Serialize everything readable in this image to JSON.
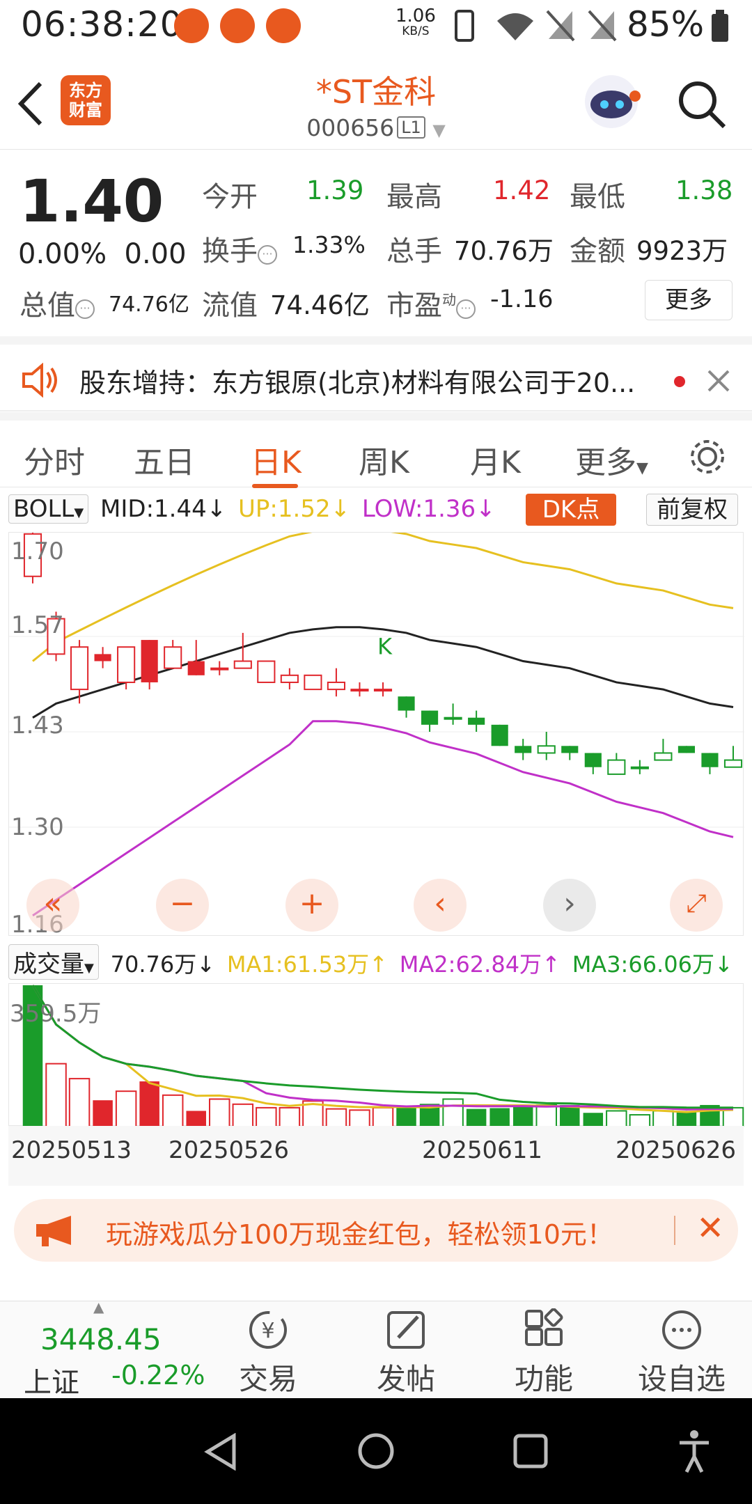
{
  "status_bar": {
    "time": "06:38:20",
    "speed_value": "1.06",
    "speed_unit": "KB/S",
    "battery": "85%"
  },
  "header": {
    "title": "*ST金科",
    "code": "000656",
    "level": "L1",
    "logo_text": "东方财富"
  },
  "quote": {
    "price": "1.40",
    "change_pct": "0.00%",
    "change": "0.00",
    "open_label": "今开",
    "open": "1.39",
    "high_label": "最高",
    "high": "1.42",
    "low_label": "最低",
    "low": "1.38",
    "turnover_label": "换手",
    "turnover": "1.33%",
    "volume_label": "总手",
    "volume": "70.76万",
    "amount_label": "金额",
    "amount": "9923万",
    "mktcap_label": "总值",
    "mktcap": "74.76亿",
    "float_label": "流值",
    "float_cap": "74.46亿",
    "pe_label": "市盈",
    "pe_sup": "动",
    "pe": "-1.16",
    "more": "更多"
  },
  "news": {
    "text": "股东增持：东方银原(北京)材料有限公司于20..."
  },
  "tabs": [
    "分时",
    "五日",
    "日K",
    "周K",
    "月K",
    "更多"
  ],
  "boll": {
    "selector": "BOLL",
    "mid": "MID:1.44",
    "up": "UP:1.52",
    "low": "LOW:1.36",
    "dk": "DK点",
    "adjust": "前复权"
  },
  "kchart_axis": [
    "1.70",
    "1.57",
    "1.43",
    "1.30",
    "1.16"
  ],
  "volume_row": {
    "selector": "成交量",
    "vol": "70.76万",
    "ma1": "MA1:61.53万",
    "ma2": "MA2:62.84万",
    "ma3": "MA3:66.06万"
  },
  "volume_axis_max": "359.5万",
  "dates": [
    "20250513",
    "20250526",
    "20250611",
    "20250626"
  ],
  "promo": {
    "text": "玩游戏瓜分100万现金红包，轻松领10元！"
  },
  "bottom_bar": {
    "index_value": "3448.45",
    "index_name": "上证",
    "index_pct": "-0.22%",
    "items": [
      "交易",
      "发帖",
      "功能",
      "设自选"
    ]
  },
  "colors": {
    "accent": "#e8591f",
    "up": "#e0262c",
    "down": "#1a9c2a",
    "mid_line": "#222222",
    "upper_band": "#e6c020",
    "lower_band": "#c030c8"
  },
  "chart_data": {
    "type": "candlestick",
    "series": [
      {
        "o": 1.65,
        "c": 1.71,
        "h": 1.72,
        "l": 1.64
      },
      {
        "o": 1.54,
        "c": 1.59,
        "h": 1.6,
        "l": 1.53
      },
      {
        "o": 1.49,
        "c": 1.55,
        "h": 1.56,
        "l": 1.47
      },
      {
        "o": 1.54,
        "c": 1.53,
        "h": 1.55,
        "l": 1.52
      },
      {
        "o": 1.5,
        "c": 1.55,
        "h": 1.55,
        "l": 1.49
      },
      {
        "o": 1.56,
        "c": 1.5,
        "h": 1.56,
        "l": 1.49
      },
      {
        "o": 1.52,
        "c": 1.55,
        "h": 1.56,
        "l": 1.52
      },
      {
        "o": 1.53,
        "c": 1.51,
        "h": 1.56,
        "l": 1.51
      },
      {
        "o": 1.52,
        "c": 1.52,
        "h": 1.53,
        "l": 1.51
      },
      {
        "o": 1.52,
        "c": 1.53,
        "h": 1.57,
        "l": 1.52
      },
      {
        "o": 1.5,
        "c": 1.53,
        "h": 1.53,
        "l": 1.5
      },
      {
        "o": 1.5,
        "c": 1.51,
        "h": 1.52,
        "l": 1.49
      },
      {
        "o": 1.49,
        "c": 1.51,
        "h": 1.51,
        "l": 1.49
      },
      {
        "o": 1.49,
        "c": 1.5,
        "h": 1.52,
        "l": 1.48
      },
      {
        "o": 1.49,
        "c": 1.49,
        "h": 1.5,
        "l": 1.48
      },
      {
        "o": 1.49,
        "c": 1.49,
        "h": 1.5,
        "l": 1.48
      },
      {
        "o": 1.48,
        "c": 1.46,
        "h": 1.48,
        "l": 1.45
      },
      {
        "o": 1.46,
        "c": 1.44,
        "h": 1.46,
        "l": 1.43
      },
      {
        "o": 1.45,
        "c": 1.45,
        "h": 1.47,
        "l": 1.44
      },
      {
        "o": 1.45,
        "c": 1.44,
        "h": 1.46,
        "l": 1.43
      },
      {
        "o": 1.44,
        "c": 1.41,
        "h": 1.44,
        "l": 1.41
      },
      {
        "o": 1.41,
        "c": 1.4,
        "h": 1.42,
        "l": 1.39
      },
      {
        "o": 1.4,
        "c": 1.41,
        "h": 1.43,
        "l": 1.39
      },
      {
        "o": 1.41,
        "c": 1.4,
        "h": 1.41,
        "l": 1.39
      },
      {
        "o": 1.4,
        "c": 1.38,
        "h": 1.4,
        "l": 1.37
      },
      {
        "o": 1.37,
        "c": 1.39,
        "h": 1.4,
        "l": 1.37
      },
      {
        "o": 1.38,
        "c": 1.38,
        "h": 1.39,
        "l": 1.37
      },
      {
        "o": 1.39,
        "c": 1.4,
        "h": 1.42,
        "l": 1.39
      },
      {
        "o": 1.41,
        "c": 1.4,
        "h": 1.41,
        "l": 1.4
      },
      {
        "o": 1.4,
        "c": 1.38,
        "h": 1.4,
        "l": 1.37
      },
      {
        "o": 1.38,
        "c": 1.39,
        "h": 1.41,
        "l": 1.38
      }
    ],
    "volumes": [
      359.5,
      160,
      122,
      67,
      90,
      115,
      80,
      40,
      70,
      57,
      48,
      48,
      65,
      45,
      42,
      48,
      50,
      58,
      70,
      45,
      47,
      50,
      55,
      55,
      35,
      40,
      30,
      40,
      40,
      55,
      48
    ],
    "mid": [
      1.45,
      1.47,
      1.48,
      1.49,
      1.5,
      1.51,
      1.52,
      1.53,
      1.54,
      1.55,
      1.56,
      1.57,
      1.575,
      1.578,
      1.578,
      1.575,
      1.57,
      1.56,
      1.555,
      1.55,
      1.54,
      1.53,
      1.525,
      1.52,
      1.51,
      1.5,
      1.495,
      1.49,
      1.48,
      1.47,
      1.465
    ],
    "ylim": [
      1.16,
      1.7
    ]
  }
}
